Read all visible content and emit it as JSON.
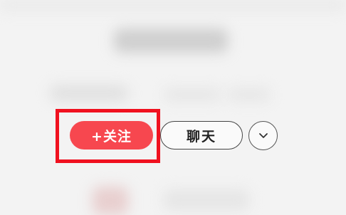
{
  "actions": {
    "follow_label": "+关注",
    "chat_label": "聊天",
    "more_icon": "chevron-down-icon"
  },
  "colors": {
    "follow_button": "#f7474f",
    "highlight": "#f0111f"
  }
}
